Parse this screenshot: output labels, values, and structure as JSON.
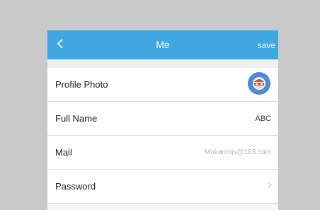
{
  "navbar": {
    "title": "Me",
    "save_label": "save",
    "back_icon": "chevron-left-icon"
  },
  "rows": [
    {
      "label": "Profile Photo",
      "value": ""
    },
    {
      "label": "Full Name",
      "value": "ABC"
    },
    {
      "label": "Mail",
      "value": "Mokanmjs@163.com"
    },
    {
      "label": "Password",
      "value": ""
    }
  ],
  "colors": {
    "navbar": "#3fa7e2",
    "background": "#c9c9c9"
  }
}
